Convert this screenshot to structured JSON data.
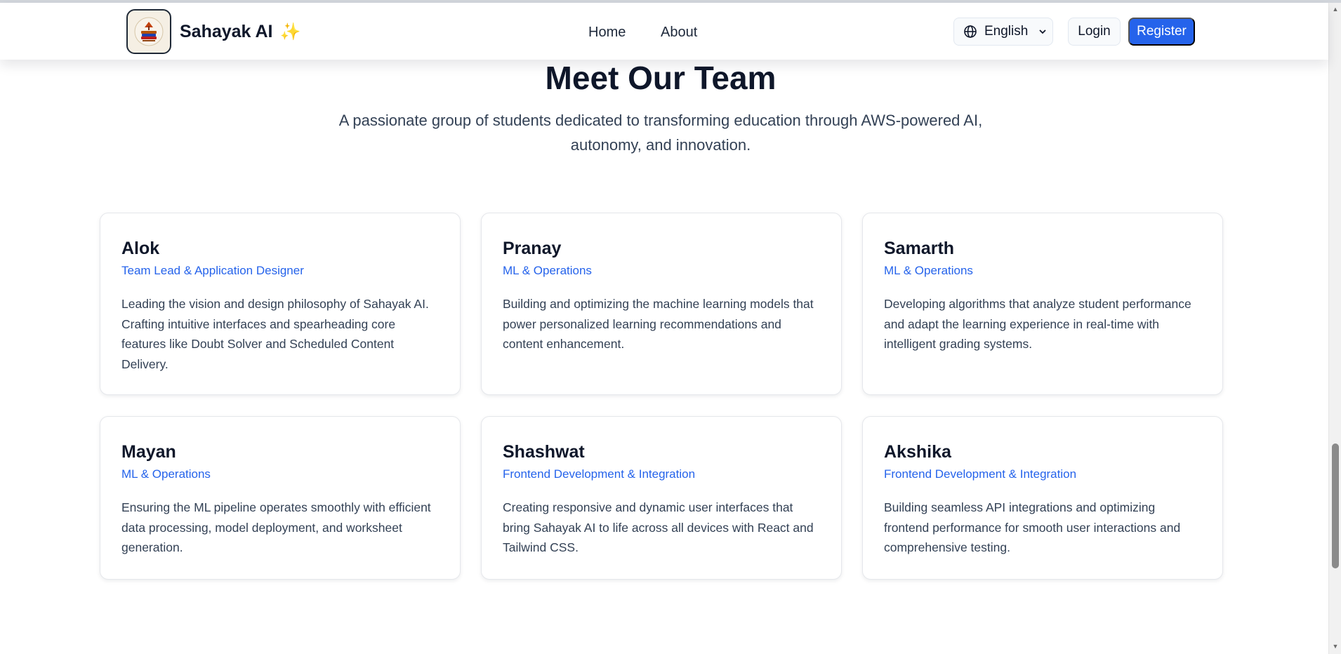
{
  "header": {
    "brand": "Sahayak AI",
    "sparkle": "✨",
    "logo_icon": "book-stack-logo-icon",
    "nav": [
      {
        "label": "Home"
      },
      {
        "label": "About"
      }
    ],
    "language": {
      "label": "English",
      "icon": "globe-icon",
      "chevron": "chevron-down-icon"
    },
    "login_label": "Login",
    "register_label": "Register",
    "accent": "#2563eb"
  },
  "team_section": {
    "title": "Meet Our Team",
    "subtitle": "A passionate group of students dedicated to transforming education through AWS-powered AI, autonomy, and innovation."
  },
  "members": [
    {
      "name": "Alok",
      "role": "Team Lead & Application Designer",
      "description": "Leading the vision and design philosophy of Sahayak AI. Crafting intuitive interfaces and spearheading core features like Doubt Solver and Scheduled Content Delivery."
    },
    {
      "name": "Pranay",
      "role": "ML & Operations",
      "description": "Building and optimizing the machine learning models that power personalized learning recommendations and content enhancement."
    },
    {
      "name": "Samarth",
      "role": "ML & Operations",
      "description": "Developing algorithms that analyze student performance and adapt the learning experience in real-time with intelligent grading systems."
    },
    {
      "name": "Mayan",
      "role": "ML & Operations",
      "description": "Ensuring the ML pipeline operates smoothly with efficient data processing, model deployment, and worksheet generation."
    },
    {
      "name": "Shashwat",
      "role": "Frontend Development & Integration",
      "description": "Creating responsive and dynamic user interfaces that bring Sahayak AI to life across all devices with React and Tailwind CSS."
    },
    {
      "name": "Akshika",
      "role": "Frontend Development & Integration",
      "description": "Building seamless API integrations and optimizing frontend performance for smooth user interactions and comprehensive testing."
    }
  ]
}
